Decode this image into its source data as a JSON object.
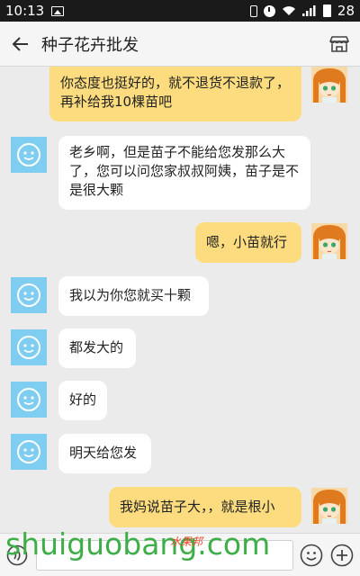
{
  "status_bar": {
    "time": "10:13",
    "battery": "28"
  },
  "header": {
    "title": "种子花卉批发"
  },
  "messages": [
    {
      "side": "out",
      "text": "你态度也挺好的，就不退货不退款了，再补给我10棵苗吧"
    },
    {
      "side": "in",
      "text": "老乡啊，但是苗子不能给您发那么大了，您可以问您家叔叔阿姨，苗子是不是很大颗"
    },
    {
      "side": "out",
      "text": "嗯，小苗就行"
    },
    {
      "side": "in",
      "text": "我以为你您就买十颗"
    },
    {
      "side": "in",
      "text": "都发大的"
    },
    {
      "side": "in",
      "text": "好的"
    },
    {
      "side": "in",
      "text": "明天给您发"
    },
    {
      "side": "out",
      "text": "我妈说苗子大，，就是根小"
    }
  ],
  "input": {
    "value": ""
  },
  "watermark": {
    "text": "shuiguobang.com",
    "cn": "水果邦"
  },
  "colors": {
    "out_bubble": "#fcdc7e",
    "in_bubble": "#ffffff",
    "bot_avatar": "#7fcdf0",
    "background": "#ebebeb"
  }
}
